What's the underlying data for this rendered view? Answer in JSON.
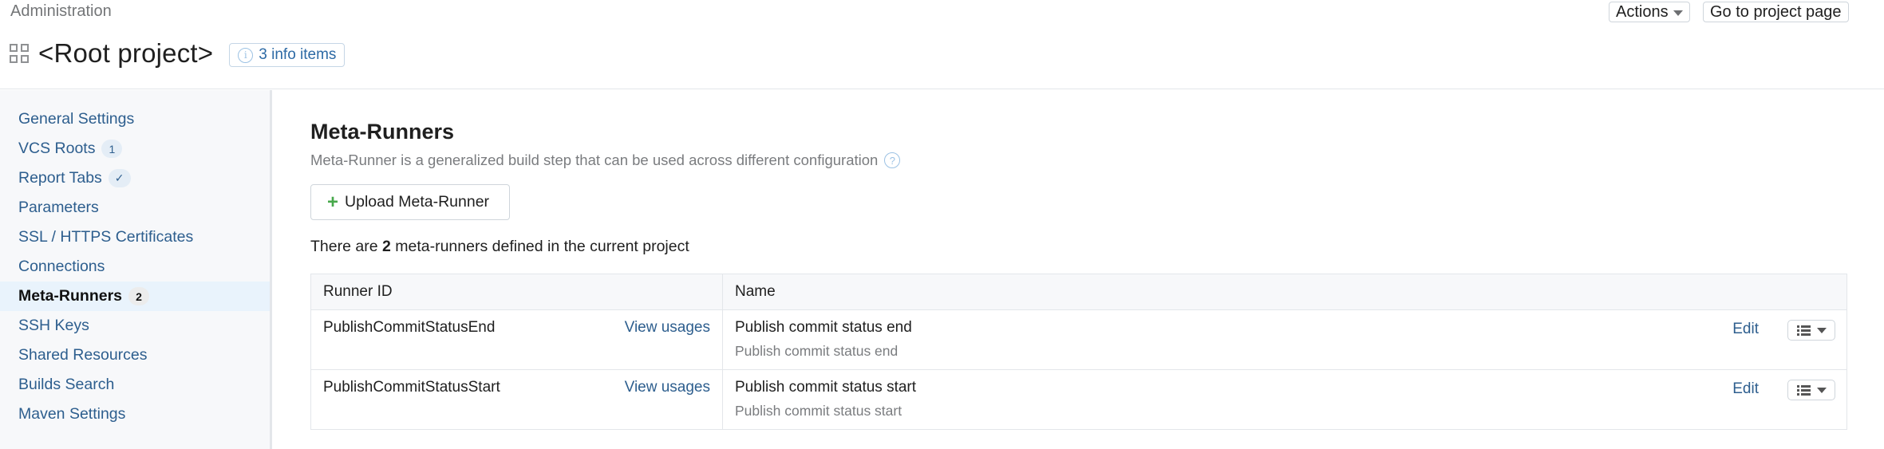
{
  "header": {
    "breadcrumb": "Administration",
    "title": "<Root project>",
    "info_badge": "3 info items",
    "actions_label": "Actions",
    "goto_label": "Go to project page"
  },
  "sidebar": {
    "items": [
      {
        "label": "General Settings",
        "badge": null,
        "active": false
      },
      {
        "label": "VCS Roots",
        "badge": "1",
        "active": false
      },
      {
        "label": "Report Tabs",
        "badge": "✓",
        "active": false
      },
      {
        "label": "Parameters",
        "badge": null,
        "active": false
      },
      {
        "label": "SSL / HTTPS Certificates",
        "badge": null,
        "active": false
      },
      {
        "label": "Connections",
        "badge": null,
        "active": false
      },
      {
        "label": "Meta-Runners",
        "badge": "2",
        "active": true
      },
      {
        "label": "SSH Keys",
        "badge": null,
        "active": false
      },
      {
        "label": "Shared Resources",
        "badge": null,
        "active": false
      },
      {
        "label": "Builds Search",
        "badge": null,
        "active": false
      },
      {
        "label": "Maven Settings",
        "badge": null,
        "active": false
      }
    ]
  },
  "main": {
    "title": "Meta-Runners",
    "description": "Meta-Runner is a generalized build step that can be used across different configuration",
    "upload_label": "Upload Meta-Runner",
    "count_prefix": "There are ",
    "count_value": "2",
    "count_suffix": " meta-runners defined in the current project",
    "table": {
      "headers": [
        "Runner ID",
        "Name"
      ],
      "rows": [
        {
          "id": "PublishCommitStatusEnd",
          "usages": "View usages",
          "name": "Publish commit status end",
          "description": "Publish commit status end",
          "edit": "Edit"
        },
        {
          "id": "PublishCommitStatusStart",
          "usages": "View usages",
          "name": "Publish commit status start",
          "description": "Publish commit status start",
          "edit": "Edit"
        }
      ]
    }
  },
  "colors": {
    "link": "#2d5e8e",
    "plus": "#47a84b",
    "active_bg": "#e9f3fc",
    "sidebar_bg": "#f7f8fa"
  }
}
